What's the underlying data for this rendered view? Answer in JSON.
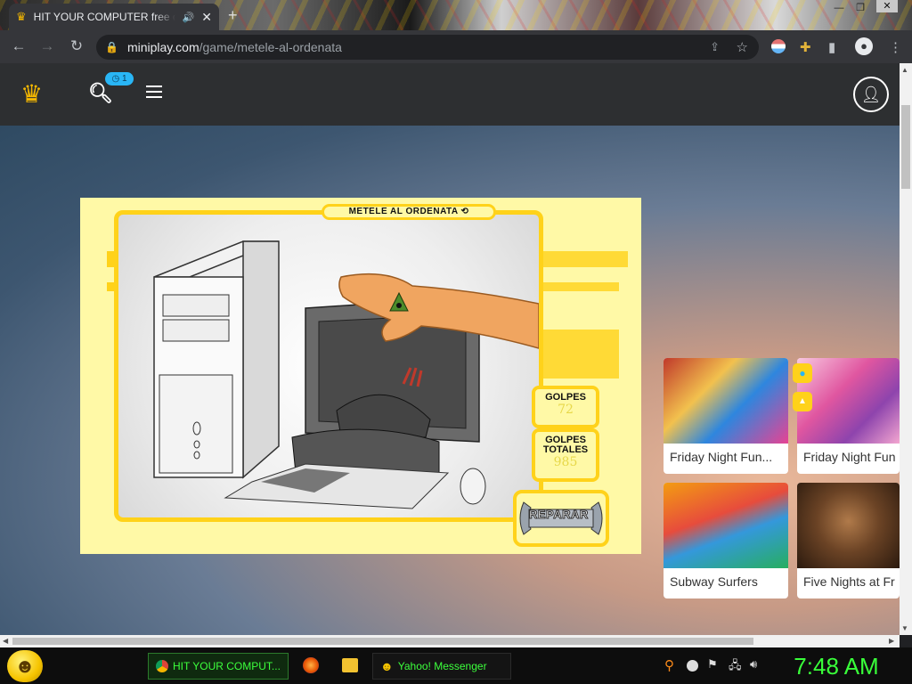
{
  "browser": {
    "tab_title": "HIT YOUR COMPUTER free o",
    "new_tab": "+",
    "url_host": "miniplay.com",
    "url_path": "/game/metele-al-ordenata"
  },
  "site": {
    "badge_count": "1"
  },
  "game": {
    "title": "METELE AL ORDENATA",
    "score_label_1": "GOLPES",
    "score_value_1": "72",
    "score_label_2_line1": "GOLPES",
    "score_label_2_line2": "TOTALES",
    "score_value_2": "985",
    "repair_label": "REPARAR"
  },
  "related": [
    {
      "label": "Friday Night Fun..."
    },
    {
      "label": "Friday Night Fun"
    },
    {
      "label": "Subway Surfers"
    },
    {
      "label": "Five Nights at Fr"
    }
  ],
  "taskbar": {
    "chrome_label": "HIT YOUR COMPUT...",
    "messenger_label": "Yahoo! Messenger",
    "clock": "7:48 AM"
  },
  "colors": {
    "game_yellow": "#ffd21a",
    "game_bg": "#fff9a6",
    "badge_blue": "#29b6f6",
    "clock_green": "#39ff3a"
  }
}
